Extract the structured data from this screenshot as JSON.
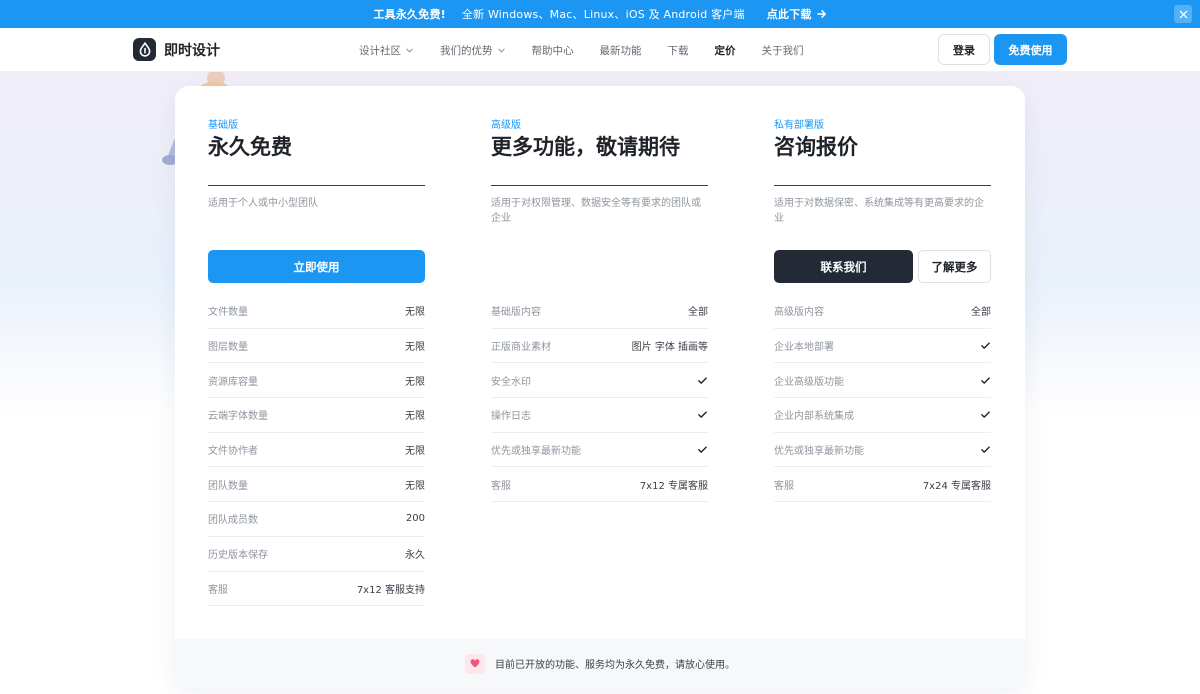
{
  "promo": {
    "headline": "工具永久免费!",
    "platforms": "全新 Windows、Mac、Linux、iOS 及 Android 客户端",
    "cta": "点此下载"
  },
  "nav": {
    "logo_text": "即时设计",
    "menu": [
      {
        "label": "设计社区",
        "dropdown": true
      },
      {
        "label": "我们的优势",
        "dropdown": true
      },
      {
        "label": "帮助中心",
        "dropdown": false
      },
      {
        "label": "最新功能",
        "dropdown": false
      },
      {
        "label": "下载",
        "dropdown": false
      },
      {
        "label": "定价",
        "dropdown": false,
        "active": true
      },
      {
        "label": "关于我们",
        "dropdown": false
      }
    ],
    "login_label": "登录",
    "free_label": "免费使用"
  },
  "plans": [
    {
      "tier": "基础版",
      "title": "永久免费",
      "desc": "适用于个人或中小型团队",
      "primary_label": "立即使用",
      "features": [
        {
          "name": "文件数量",
          "value": "无限"
        },
        {
          "name": "图层数量",
          "value": "无限"
        },
        {
          "name": "资源库容量",
          "value": "无限"
        },
        {
          "name": "云端字体数量",
          "value": "无限"
        },
        {
          "name": "文件协作者",
          "value": "无限"
        },
        {
          "name": "团队数量",
          "value": "无限"
        },
        {
          "name": "团队成员数",
          "value": "200"
        },
        {
          "name": "历史版本保存",
          "value": "永久"
        },
        {
          "name": "客服",
          "value": "7x12 客服支持"
        }
      ]
    },
    {
      "tier": "高级版",
      "title": "更多功能，敬请期待",
      "desc": "适用于对权限管理、数据安全等有要求的团队或企业",
      "features": [
        {
          "name": "基础版内容",
          "value": "全部"
        },
        {
          "name": "正版商业素材",
          "value": "图片 字体 插画等"
        },
        {
          "name": "安全水印",
          "value": "check"
        },
        {
          "name": "操作日志",
          "value": "check"
        },
        {
          "name": "优先或独享最新功能",
          "value": "check"
        },
        {
          "name": "客服",
          "value": "7x12 专属客服"
        }
      ]
    },
    {
      "tier": "私有部署版",
      "title": "咨询报价",
      "desc": "适用于对数据保密、系统集成等有更高要求的企业",
      "primary_label": "联系我们",
      "secondary_label": "了解更多",
      "features": [
        {
          "name": "高级版内容",
          "value": "全部"
        },
        {
          "name": "企业本地部署",
          "value": "check"
        },
        {
          "name": "企业高级版功能",
          "value": "check"
        },
        {
          "name": "企业内部系统集成",
          "value": "check"
        },
        {
          "name": "优先或独享最新功能",
          "value": "check"
        },
        {
          "name": "客服",
          "value": "7x24 专属客服"
        }
      ]
    }
  ],
  "note": "目前已开放的功能、服务均为永久免费，请放心使用。",
  "colors": {
    "brand_blue": "#1b97f3",
    "dark_button": "#232a35",
    "heart": "#f0567a"
  },
  "icons": [
    "close-icon",
    "arrow-right-icon",
    "chevron-down-icon",
    "logo-drop-icon",
    "check-icon",
    "heart-icon"
  ]
}
